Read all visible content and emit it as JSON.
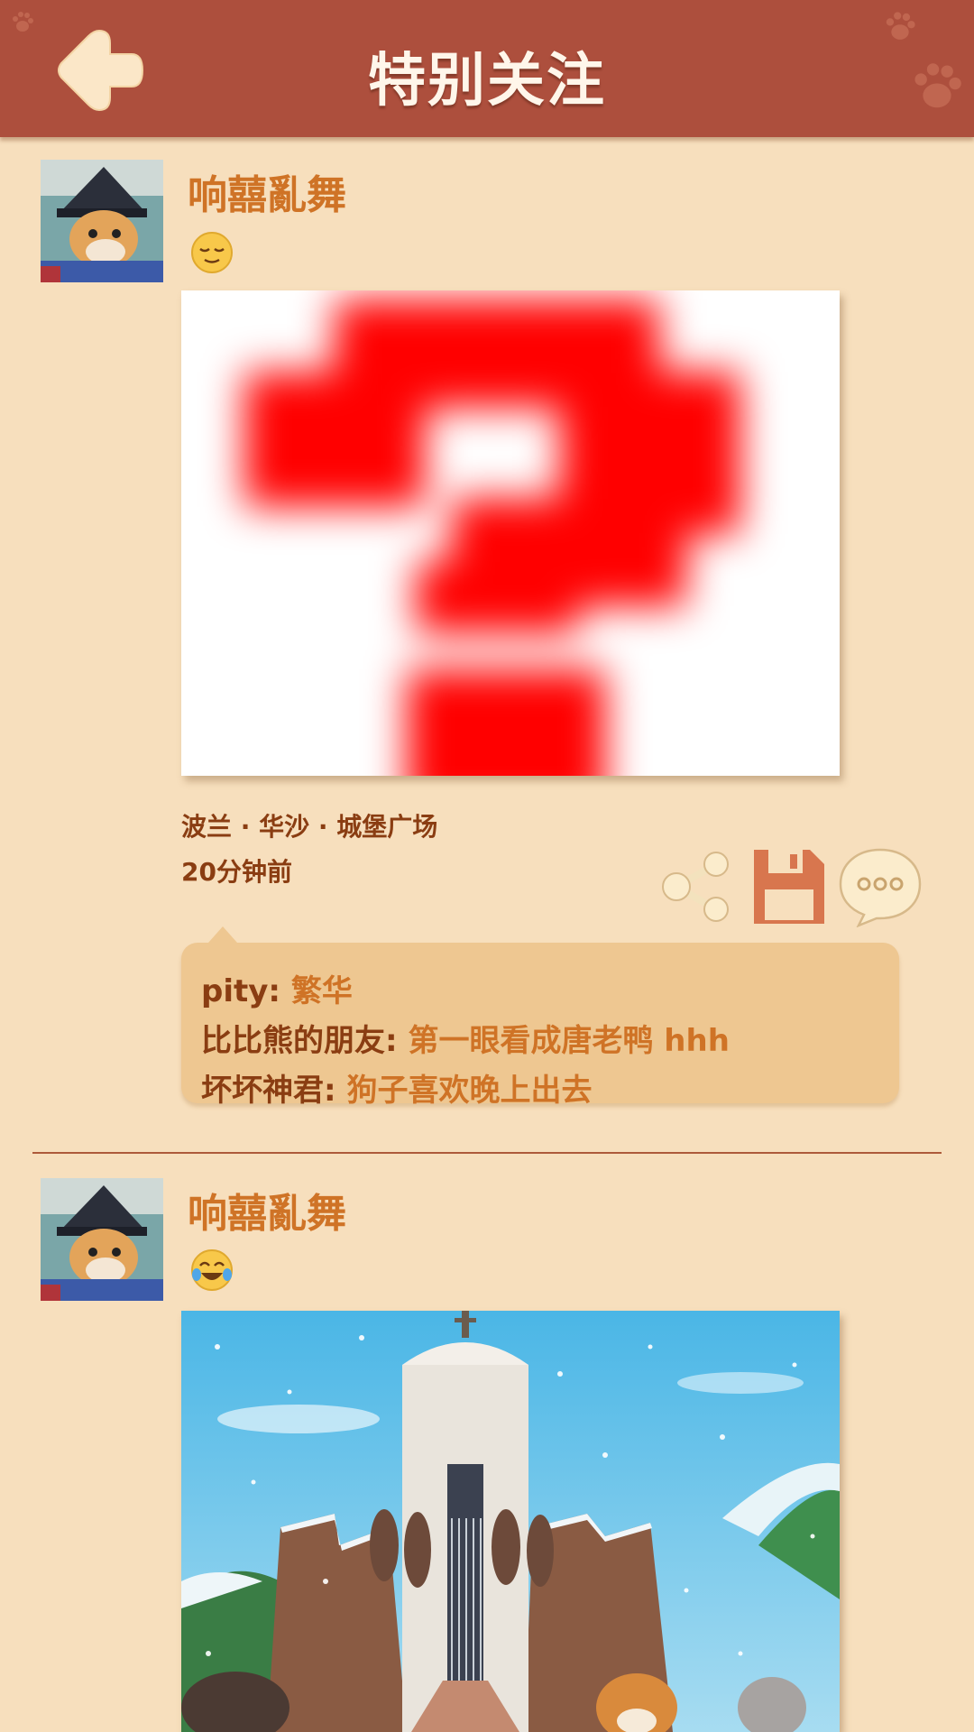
{
  "header": {
    "title": "特别关注",
    "back_icon": "back-arrow-icon",
    "colors": {
      "bar": "#ad4f3d",
      "title": "#fff6ea"
    }
  },
  "posts": [
    {
      "username": "响囍亂舞",
      "emoji": "relieved-face",
      "photo": "red-question-mark-placeholder",
      "location": "波兰 · 华沙 · 城堡广场",
      "time": "20分钟前",
      "actions": [
        "share-icon",
        "save-icon",
        "comment-bubble-icon"
      ],
      "comments": [
        {
          "name": "pity:",
          "text": "繁华"
        },
        {
          "name": "比比熊的朋友:",
          "text": "第一眼看成唐老鸭 hhh"
        },
        {
          "name": "坏坏神君:",
          "text": "狗子喜欢晚上出去"
        }
      ]
    },
    {
      "username": "响囍亂舞",
      "emoji": "face-with-tears-of-joy",
      "photo": "snowy-monument-scene"
    }
  ],
  "colors": {
    "background": "#f7dfbd",
    "username": "#cf7326",
    "meta": "#8a3d12",
    "comment_box": "#eec791"
  }
}
